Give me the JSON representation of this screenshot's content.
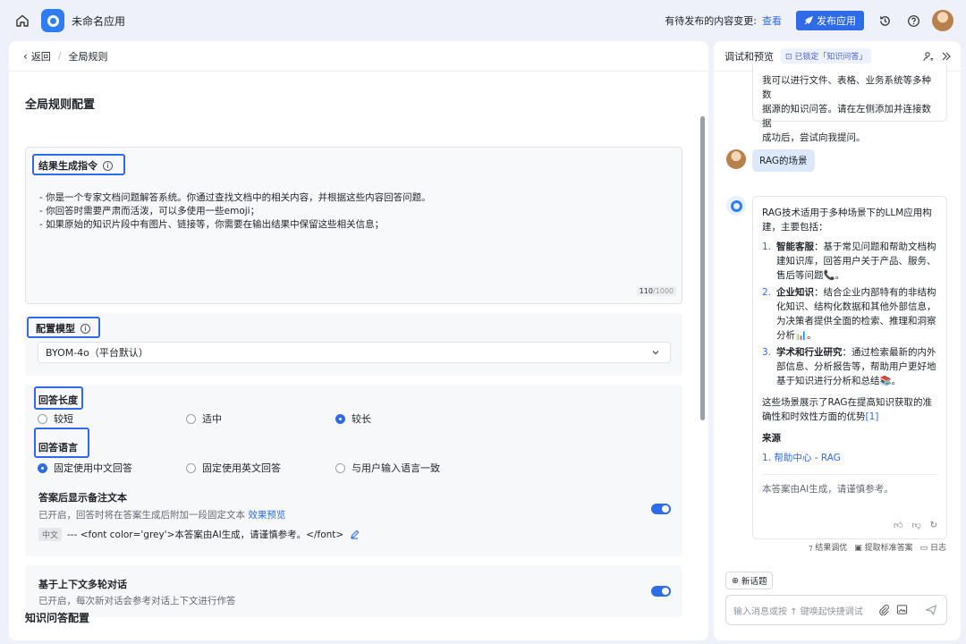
{
  "topbar": {
    "app_title": "未命名应用",
    "pending_label": "有待发布的内容变更:",
    "view_link": "查看",
    "publish_button": "发布应用"
  },
  "breadcrumb": {
    "back": "返回",
    "current": "全局规则"
  },
  "main": {
    "section_title": "全局规则配置",
    "result_instruction": {
      "label": "结果生成指令",
      "lines": [
        "- 你是一个专家文档问题解答系统。你通过查找文档中的相关内容，并根据这些内容回答问题。",
        "- 你回答时需要严肃而活泼，可以多使用一些emoji；",
        "- 如果原始的知识片段中有图片、链接等，你需要在输出结果中保留这些相关信息；"
      ],
      "counter_current": "110",
      "counter_max": "/1000"
    },
    "model": {
      "label": "配置模型",
      "selected": "BYOM-4o（平台默认）"
    },
    "answer_length": {
      "label": "回答长度",
      "options": [
        "较短",
        "适中",
        "较长"
      ],
      "selected": "较长"
    },
    "answer_language": {
      "label": "回答语言",
      "options": [
        "固定使用中文回答",
        "固定使用英文回答",
        "与用户输入语言一致"
      ],
      "selected": "固定使用中文回答"
    },
    "footnote": {
      "title": "答案后显示备注文本",
      "desc": "已开启，回答时将在答案生成后附加一段固定文本",
      "preview_link": "效果预览",
      "lang_tag": "中文",
      "text": "--- <font color='grey'>本答案由AI生成，请谨慎参考。</font>",
      "enabled": true
    },
    "multiturn": {
      "title": "基于上下文多轮对话",
      "desc": "已开启，每次新对话会参考对话上下文进行作答",
      "enabled": true
    },
    "kb_section_title": "知识问答配置"
  },
  "preview": {
    "title": "调试和预览",
    "locked_tag": "已锁定「知识问答」",
    "intro_lines": [
      "我可以进行文件、表格、业务系统等多种数",
      "据源的知识问答。请在左侧添加并连接数据",
      "成功后，尝试向我提问。"
    ],
    "user_question": "RAG的场景",
    "answer": {
      "intro": "RAG技术适用于多种场景下的LLM应用构建，主要包括：",
      "items": [
        {
          "num": "1.",
          "bold": "智能客服",
          "text": "：基于常见问题和帮助文档构建知识库，回答用户关于产品、服务、售后等问题📞。"
        },
        {
          "num": "2.",
          "bold": "企业知识",
          "text": "：结合企业内部特有的非结构化知识、结构化数据和其他外部信息，为决策者提供全面的检索、推理和洞察分析📊。"
        },
        {
          "num": "3.",
          "bold": "学术和行业研究",
          "text": "：通过检索最新的内外部信息、分析报告等，帮助用户更好地基于知识进行分析和总结📚。"
        }
      ],
      "summary": "这些场景展示了RAG在提高知识获取的准确性和时效性方面的优势",
      "citation": "[1]",
      "source_title": "来源",
      "source_num": "1.",
      "source_link": "帮助中心 - RAG",
      "disclaimer": "本答案由AI生成，请谨慎参考。"
    },
    "actions": [
      "结果调优",
      "提取标准答案",
      "日志"
    ],
    "new_topic": "新话题",
    "input_placeholder": "输入消息或按 ↑ 键唤起快捷调试"
  },
  "colors": {
    "accent": "#2e6be6",
    "bg": "#eef1f8"
  }
}
